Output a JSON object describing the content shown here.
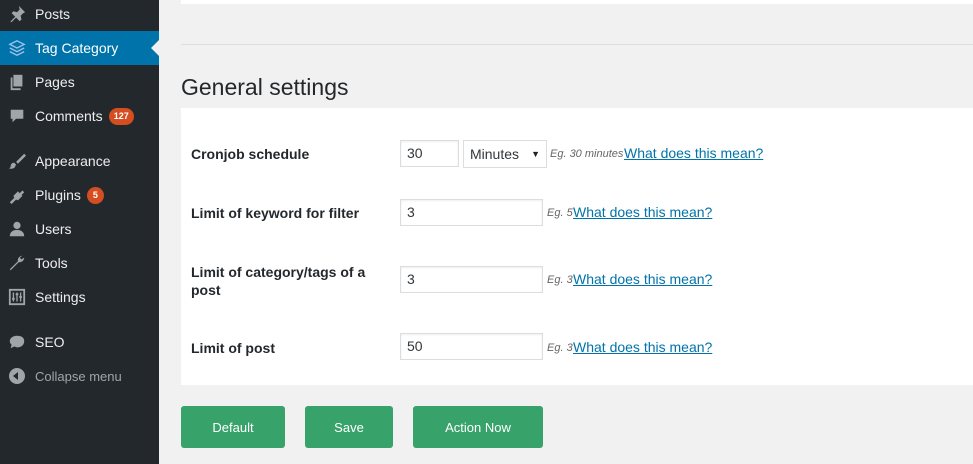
{
  "sidebar": {
    "items": [
      {
        "label": "Posts",
        "icon": "pin-icon"
      },
      {
        "label": "Tag Category",
        "icon": "layers-icon",
        "active": true
      },
      {
        "label": "Pages",
        "icon": "pages-icon"
      },
      {
        "label": "Comments",
        "icon": "comment-icon",
        "badge": "127"
      },
      {
        "label": "Appearance",
        "icon": "brush-icon"
      },
      {
        "label": "Plugins",
        "icon": "plugin-icon",
        "badge": "5"
      },
      {
        "label": "Users",
        "icon": "user-icon"
      },
      {
        "label": "Tools",
        "icon": "wrench-icon"
      },
      {
        "label": "Settings",
        "icon": "sliders-icon"
      },
      {
        "label": "SEO",
        "icon": "seo-icon"
      }
    ],
    "collapse_label": "Collapse menu"
  },
  "section_title": "General settings",
  "settings": {
    "cronjob": {
      "label": "Cronjob schedule",
      "value": "30",
      "unit": "Minutes",
      "hint": "Eg. 30 minutes",
      "help": "What does this mean?"
    },
    "keyword_limit": {
      "label": "Limit of keyword for filter",
      "value": "3",
      "hint": "Eg. 5",
      "help": "What does this mean?"
    },
    "category_limit": {
      "label": "Limit of category/tags of a post",
      "value": "3",
      "hint": "Eg. 3",
      "help": "What does this mean?"
    },
    "post_limit": {
      "label": "Limit of post",
      "value": "50",
      "hint": "Eg. 3",
      "help": "What does this mean?"
    }
  },
  "buttons": {
    "default": "Default",
    "save": "Save",
    "action_now": "Action Now"
  },
  "colors": {
    "sidebar_bg": "#23282d",
    "active_bg": "#0073aa",
    "badge": "#d54e21",
    "button_green": "#37a36b",
    "link": "#0073aa"
  }
}
